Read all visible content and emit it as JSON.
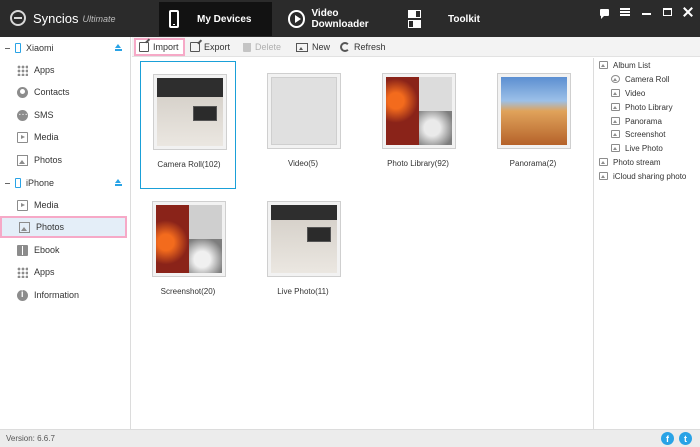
{
  "app": {
    "name": "Syncios",
    "edition": "Ultimate"
  },
  "nav_tabs": {
    "devices": "My Devices",
    "video": "Video Downloader",
    "toolkit": "Toolkit"
  },
  "devices": [
    {
      "name": "Xiaomi"
    },
    {
      "name": "iPhone"
    }
  ],
  "sidebar": {
    "xiaomi_items": [
      {
        "label": "Apps",
        "icon": "apps-icon"
      },
      {
        "label": "Contacts",
        "icon": "contacts-icon"
      },
      {
        "label": "SMS",
        "icon": "sms-icon"
      },
      {
        "label": "Media",
        "icon": "media-icon"
      },
      {
        "label": "Photos",
        "icon": "photos-icon"
      }
    ],
    "iphone_items": [
      {
        "label": "Media",
        "icon": "media-icon"
      },
      {
        "label": "Photos",
        "icon": "photos-icon",
        "selected": true
      },
      {
        "label": "Ebook",
        "icon": "ebook-icon"
      },
      {
        "label": "Apps",
        "icon": "apps-icon"
      },
      {
        "label": "Information",
        "icon": "info-icon"
      }
    ]
  },
  "toolbar": {
    "import": "Import",
    "export": "Export",
    "delete": "Delete",
    "new": "New",
    "refresh": "Refresh"
  },
  "albums": [
    {
      "name": "Camera Roll(102)",
      "selected": true
    },
    {
      "name": "Video(5)"
    },
    {
      "name": "Photo Library(92)"
    },
    {
      "name": "Panorama(2)"
    },
    {
      "name": "Screenshot(20)"
    },
    {
      "name": "Live Photo(11)"
    }
  ],
  "album_tree": {
    "root": "Album List",
    "children": [
      "Camera Roll",
      "Video",
      "Photo Library",
      "Panorama",
      "Screenshot",
      "Live Photo"
    ],
    "extra": [
      "Photo stream",
      "iCloud sharing photo"
    ]
  },
  "status": {
    "version": "Version: 6.6.7"
  },
  "colors": {
    "accent": "#29a3e6",
    "highlight": "#f6a9c7",
    "titlebar": "#2b2b2b",
    "selection": "#1aa0d8"
  }
}
